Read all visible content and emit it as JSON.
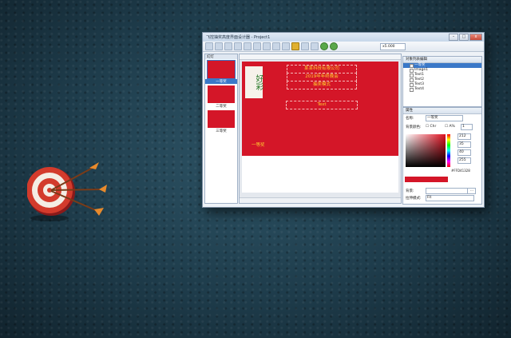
{
  "window": {
    "title": "飞控抽奖高度界面设计器 - Project1",
    "controls": {
      "minimize": "–",
      "maximize": "□",
      "close": "x"
    },
    "zoom": "x5.000"
  },
  "slides_panel": {
    "header": "幻灯",
    "slides": [
      {
        "label": "一等奖",
        "selected": true
      },
      {
        "label": "二等奖",
        "selected": false
      },
      {
        "label": "三等奖",
        "selected": false
      }
    ]
  },
  "canvas": {
    "lines": [
      "某某科技有限公司",
      "2019年年终晚会",
      "抽奖模式"
    ],
    "text_placeholder": "Text",
    "prize_label": "一等奖",
    "calligraphy": "好彩"
  },
  "objects_panel": {
    "header": "对象列表编辑",
    "items": [
      {
        "label": "一等奖",
        "selected": true
      },
      {
        "label": "Image1",
        "selected": false
      },
      {
        "label": "Text1",
        "selected": false
      },
      {
        "label": "Text2",
        "selected": false
      },
      {
        "label": "Text3",
        "selected": false
      },
      {
        "label": "Text4",
        "selected": false
      }
    ]
  },
  "properties_panel": {
    "header": "属性",
    "name_label": "名称:",
    "name_value": "一等奖",
    "color_label": "背景颜色:",
    "chk_label": "Chr",
    "alpha_label": "A%",
    "alpha_value": "1",
    "r": "212",
    "g": "35",
    "b": "40",
    "a": "255",
    "hex_value": "#FFD41328",
    "image_label": "背景:",
    "image_btn": "...",
    "mode_label": "拉伸模式:",
    "mode_value": "Fit"
  }
}
